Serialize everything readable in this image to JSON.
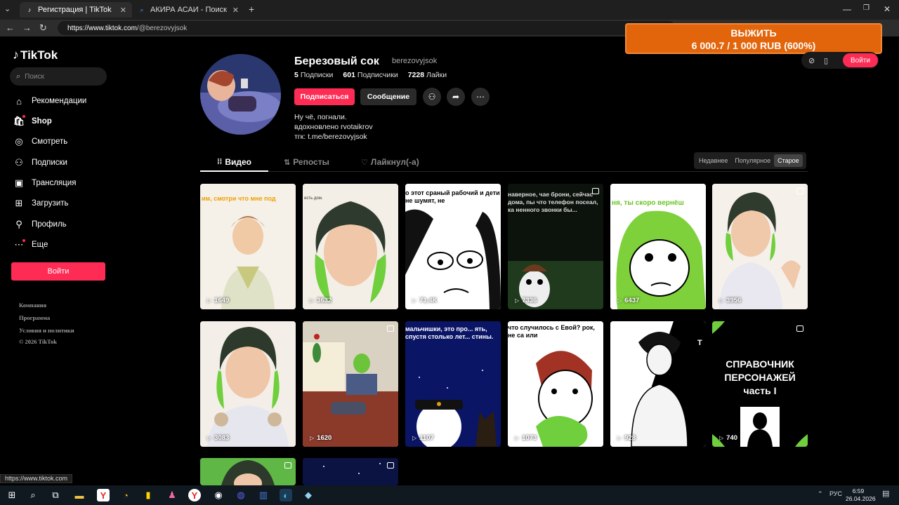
{
  "browser": {
    "tabs": [
      {
        "title": "Регистрация | TikTok",
        "active": true
      },
      {
        "title": "АКИРА АСАИ - Поиск",
        "active": false
      }
    ],
    "url_host": "https://www.tiktok.com",
    "url_path": "/@berezovyjsok",
    "status_url": "https://www.tiktok.com"
  },
  "overlay": {
    "title": "ВЫЖИТЬ",
    "progress": "6 000.7 / 1 000 RUB (600%)",
    "accent": "#e2650c"
  },
  "sidebar": {
    "logo": "TikTok",
    "search_placeholder": "Поиск",
    "items": [
      {
        "label": "Рекомендации",
        "icon": "home-icon"
      },
      {
        "label": "Shop",
        "icon": "shop-icon"
      },
      {
        "label": "Смотреть",
        "icon": "compass-icon"
      },
      {
        "label": "Подписки",
        "icon": "following-icon"
      },
      {
        "label": "Трансляция",
        "icon": "live-icon"
      },
      {
        "label": "Загрузить",
        "icon": "upload-icon"
      },
      {
        "label": "Профиль",
        "icon": "profile-icon"
      },
      {
        "label": "Еще",
        "icon": "more-icon"
      }
    ],
    "login_label": "Войти",
    "footer": [
      "Компания",
      "Программа",
      "Условия и политики",
      "© 2026 TikTok"
    ]
  },
  "header_right": {
    "login_label": "Войти"
  },
  "profile": {
    "name": "Березовый сок",
    "handle": "berezovyjsok",
    "following_count": "5",
    "following_label": "Подписки",
    "followers_count": "601",
    "followers_label": "Подписчики",
    "likes_count": "7228",
    "likes_label": "Лайки",
    "follow_label": "Подписаться",
    "message_label": "Сообщение",
    "bio": [
      "Ну чё, погнали.",
      "вдохновлено rvotaikrov",
      "тгк: t.me/berezovyjsok"
    ]
  },
  "tabs": [
    {
      "label": "Видео",
      "active": true
    },
    {
      "label": "Репосты",
      "active": false
    },
    {
      "label": "Лайкнул(-а)",
      "active": false
    }
  ],
  "sort": {
    "options": [
      "Недавнее",
      "Популярное",
      "Старое"
    ],
    "selected": "Старое"
  },
  "videos": [
    {
      "views": "1649",
      "caption": "им, смотри что мне под"
    },
    {
      "views": "3632",
      "caption": "есть дом."
    },
    {
      "views": "71.4K",
      "caption": "о этот сраный рабочий и дети не шумят, не"
    },
    {
      "views": "7336",
      "caption": "наверное, чае брони, сейчас дома, пы что телефон посеал, ка ненного звонки бы..."
    },
    {
      "views": "6437",
      "caption": "ня, ты скоро вернёш"
    },
    {
      "views": "3956",
      "caption": ""
    },
    {
      "views": "3083",
      "caption": ""
    },
    {
      "views": "1620",
      "caption": ""
    },
    {
      "views": "1107",
      "caption": "мальчишки, это про... ять, спустя столько лет... стины."
    },
    {
      "views": "1073",
      "caption": "что случилось с Евой? рок, не са или"
    },
    {
      "views": "928",
      "caption": "T"
    },
    {
      "views": "740",
      "caption": "СПРАВОЧНИК ПЕРСОНАЖЕЙ часть I"
    }
  ],
  "taskbar": {
    "lang": "РУС",
    "time": "6:59",
    "date": "26.04.2026"
  }
}
